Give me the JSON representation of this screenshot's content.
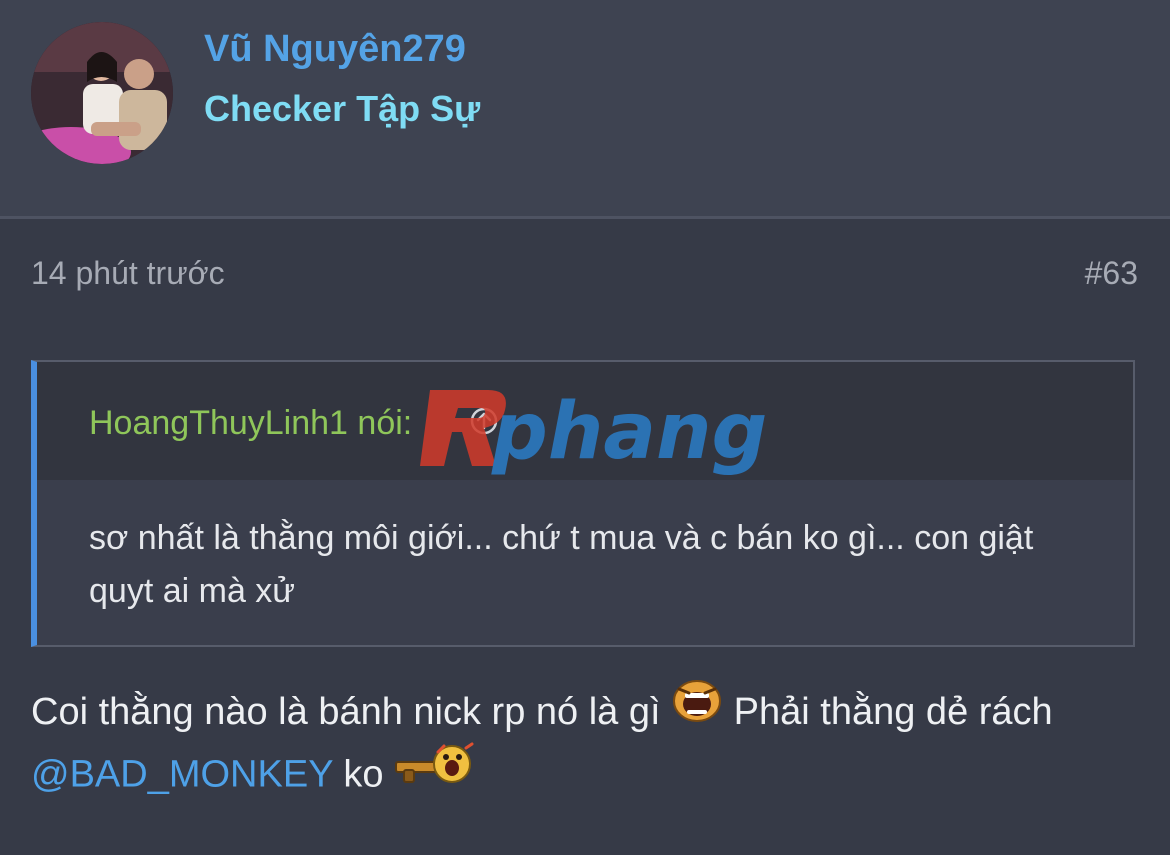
{
  "user": {
    "name": "Vũ Nguyên279",
    "title": "Checker Tập Sự"
  },
  "post": {
    "time": "14 phút trước",
    "number": "#63"
  },
  "quote": {
    "author": "HoangThuyLinh1 nói:",
    "text": "sơ nhất là thằng môi giới... chứ t mua và c bán ko gì... con giật quyt ai mà xử"
  },
  "message": {
    "part1": "Coi thằng nào là bánh nick rp nó là gì",
    "part2": "Phải thằng dẻ rách",
    "mention": "@BAD_MONKEY",
    "part3": "ko"
  },
  "watermark": {
    "text": "Rphang"
  },
  "icons": {
    "avatar": "avatar-photo",
    "quote_link": "arrow-up-circle-icon",
    "emoji1": "shouting-emoji-icon",
    "emoji2": "gun-emoji-icon"
  },
  "colors": {
    "username": "#54a3e6",
    "usertitle": "#7fdcf4",
    "quote_author": "#8fc65a",
    "mention": "#4ea1e8",
    "quote_accent": "#4a8fe0"
  }
}
